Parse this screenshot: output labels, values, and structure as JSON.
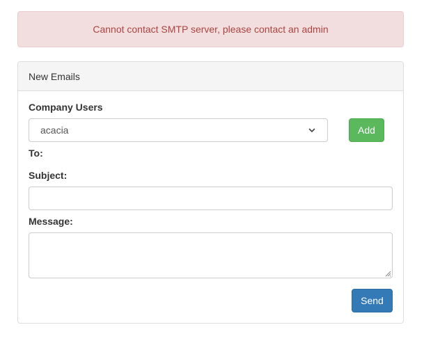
{
  "alert": {
    "message": "Cannot contact SMTP server, please contact an admin",
    "color": "#a94442",
    "background": "#f2dede"
  },
  "panel": {
    "heading": "New Emails",
    "company_users_label": "Company Users",
    "company_users_selected": "acacia",
    "add_label": "Add",
    "to_label": "To:",
    "subject_label": "Subject:",
    "subject_value": "",
    "message_label": "Message:",
    "message_value": "",
    "send_label": "Send"
  },
  "colors": {
    "add_button": "#5cb85c",
    "send_button": "#337ab7"
  },
  "icons": {
    "select_chevron": "chevron-down-icon",
    "resize_grip": "resize-grip-icon"
  }
}
